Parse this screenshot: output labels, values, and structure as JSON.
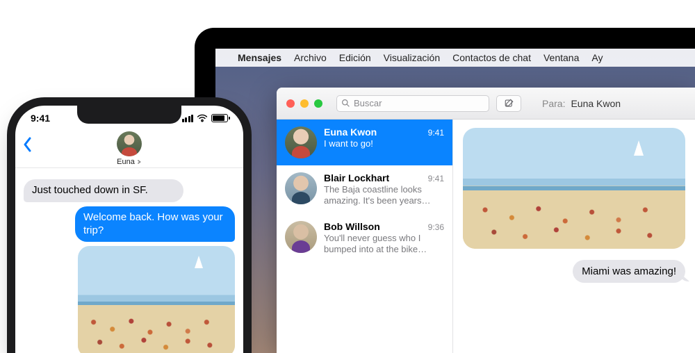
{
  "mac": {
    "menubar": {
      "app": "Mensajes",
      "items": [
        "Archivo",
        "Edición",
        "Visualización",
        "Contactos de chat",
        "Ventana",
        "Ay"
      ]
    },
    "window": {
      "search_placeholder": "Buscar",
      "to_label": "Para:",
      "to_name": "Euna Kwon",
      "sidebar": [
        {
          "name": "Euna Kwon",
          "time": "9:41",
          "preview": "I want to go!",
          "active": true
        },
        {
          "name": "Blair Lockhart",
          "time": "9:41",
          "preview": "The Baja coastline looks amazing. It's been years since…",
          "active": false
        },
        {
          "name": "Bob Willson",
          "time": "9:36",
          "preview": "You'll never guess who I bumped into at the bike shop…",
          "active": false
        }
      ],
      "reply_bubble": "Miami was amazing!"
    }
  },
  "iphone": {
    "clock": "9:41",
    "contact_name": "Euna",
    "messages": {
      "incoming": "Just touched down in SF.",
      "outgoing": "Welcome back. How was your trip?"
    }
  }
}
